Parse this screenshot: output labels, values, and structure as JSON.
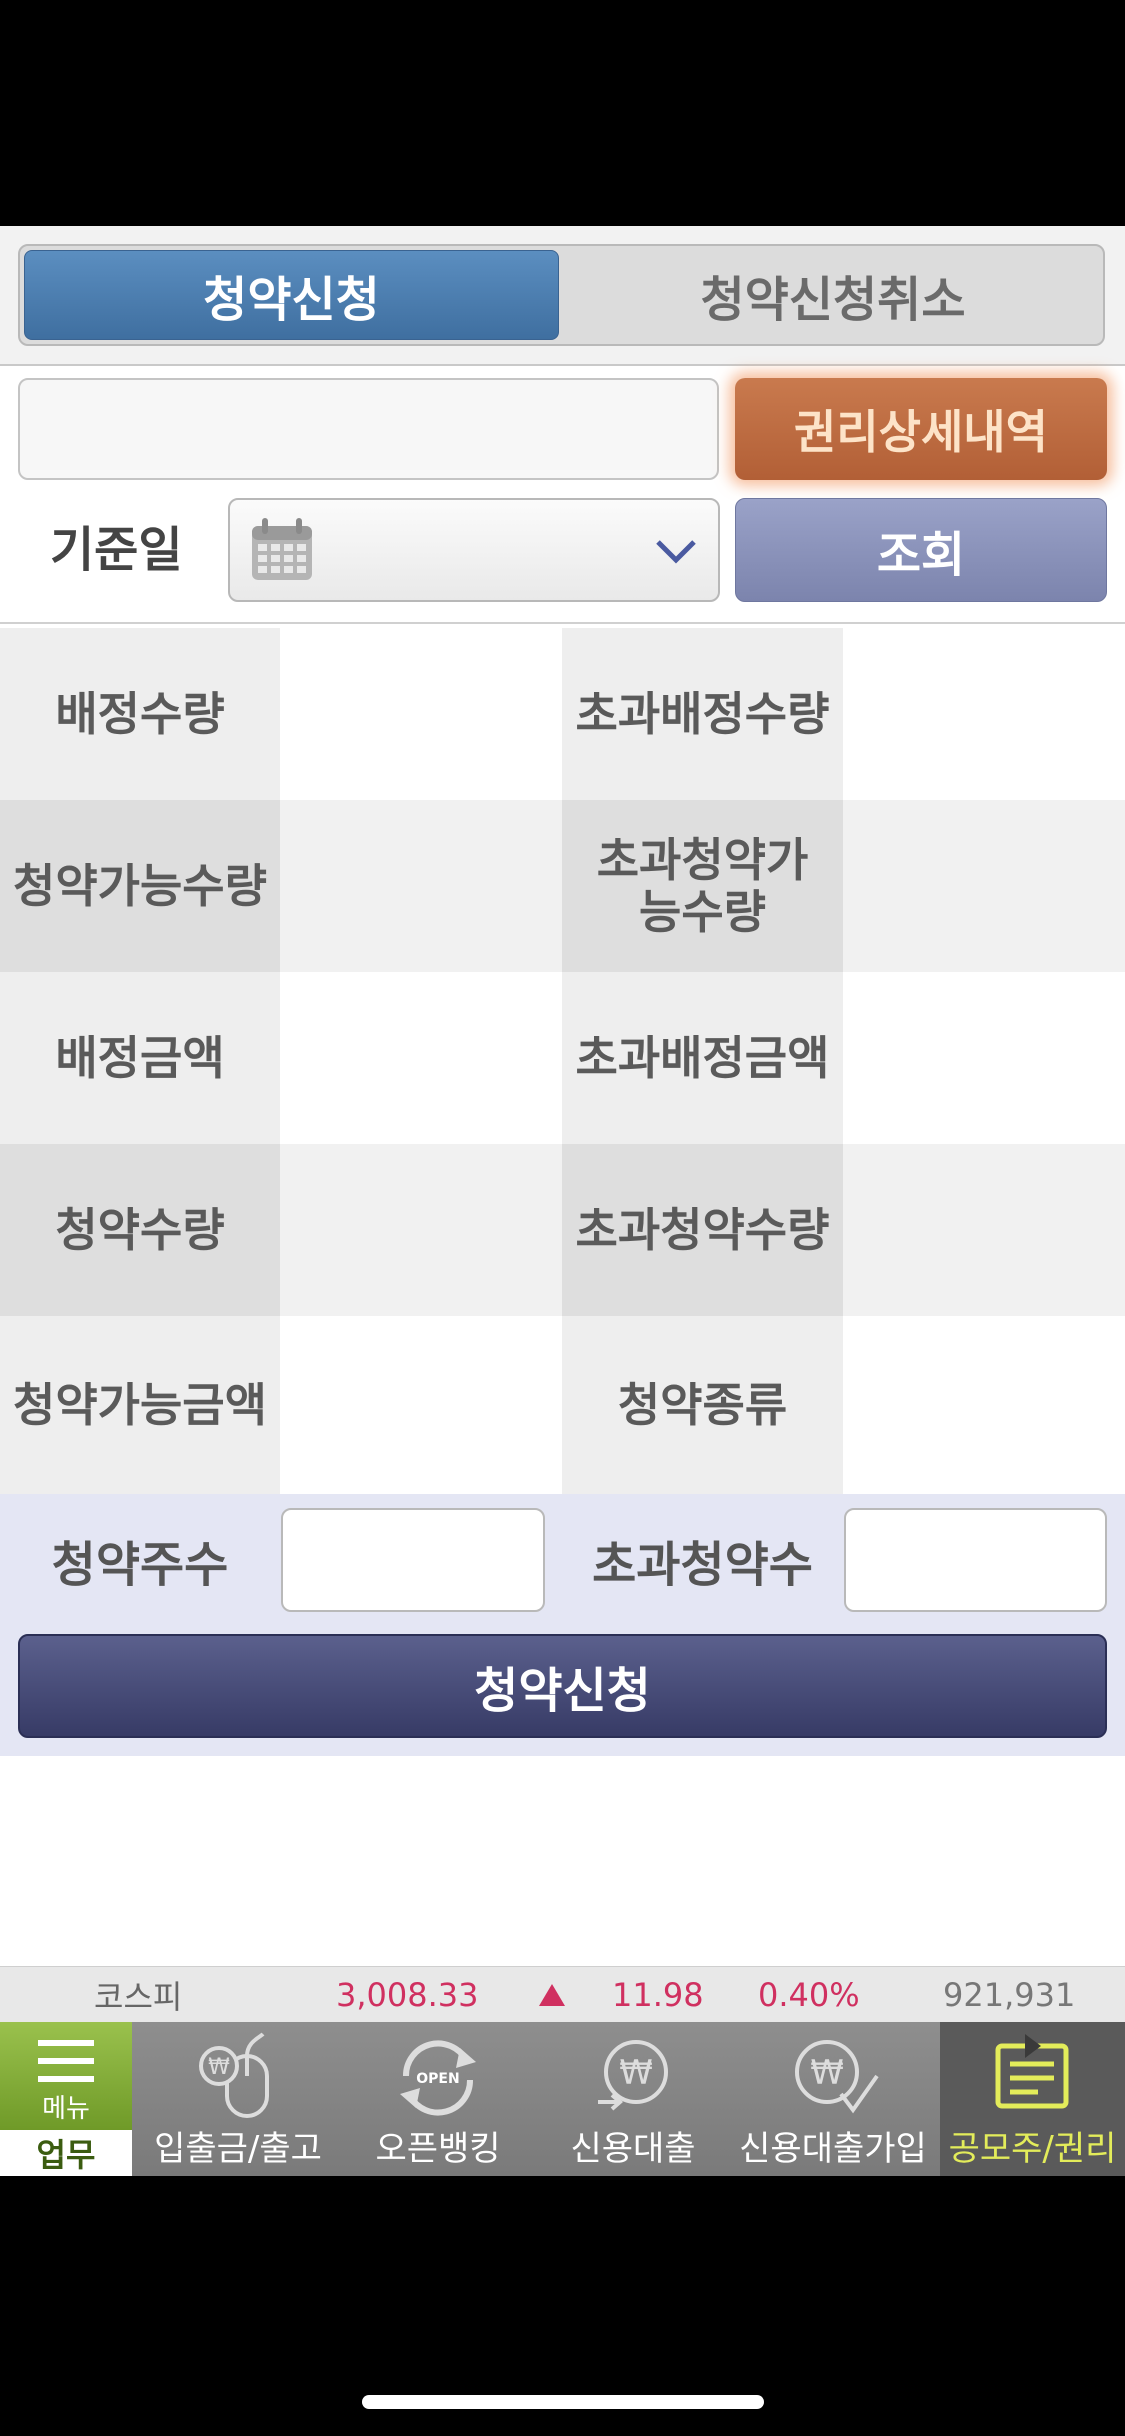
{
  "tabs": {
    "apply": "청약신청",
    "cancel": "청약신청취소"
  },
  "rights_button": "권리상세내역",
  "date": {
    "label": "기준일",
    "value": ""
  },
  "search_button": "조회",
  "grid": [
    [
      "배정수량",
      "",
      "초과배정수량",
      ""
    ],
    [
      "청약가능수량",
      "",
      "초과청약가능수량",
      ""
    ],
    [
      "배정금액",
      "",
      "초과배정금액",
      ""
    ],
    [
      "청약수량",
      "",
      "초과청약수량",
      ""
    ],
    [
      "청약가능금액",
      "",
      "청약종류",
      ""
    ]
  ],
  "order": {
    "shares_label": "청약주수",
    "excess_label": "초과청약수",
    "submit": "청약신청"
  },
  "ticker": {
    "index": "코스피",
    "value": "3,008.33",
    "change": "11.98",
    "percent": "0.40%",
    "volume": "921,931",
    "up_color": "#d03060"
  },
  "nav": {
    "menu": "메뉴",
    "work": "업무",
    "items": [
      "입출금/출고",
      "오픈뱅킹",
      "신용대출",
      "신용대출가입",
      "공모주/권리"
    ],
    "open_badge": "OPEN"
  }
}
